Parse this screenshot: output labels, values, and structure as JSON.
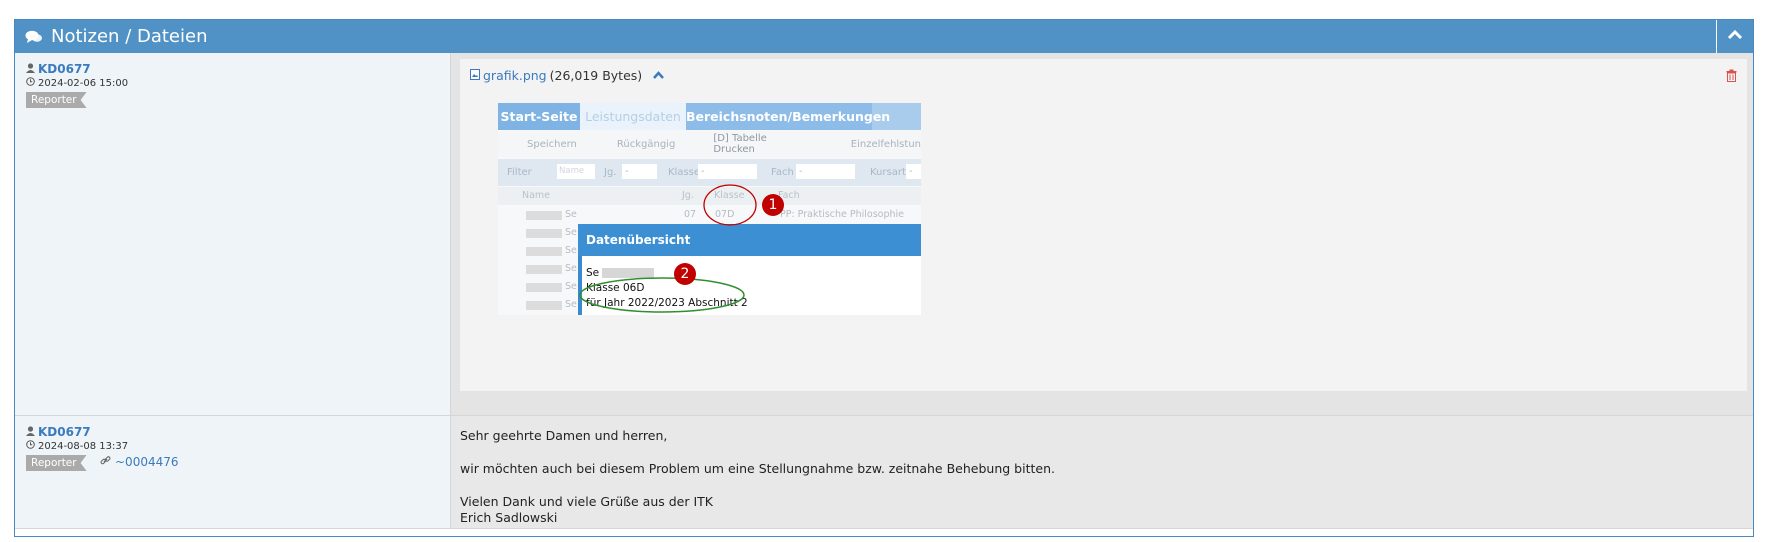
{
  "panel": {
    "title": "Notizen / Dateien",
    "icon": "comments-icon",
    "collapse_icon": "chevron-up-icon"
  },
  "notes": [
    {
      "user": "KD0677",
      "date": "2024-02-06 15:00",
      "role": "Reporter",
      "attachment": {
        "file_name": "grafik.png",
        "file_size": "(26,019 Bytes)",
        "preview": {
          "tabs": [
            "Start-Seite",
            "Leistungsdaten",
            "Bereichsnoten/Bemerkungen"
          ],
          "toolbar": [
            "Speichern",
            "Rückgängig",
            "[D] Tabelle Drucken",
            "Einzelfehlstun"
          ],
          "filter": {
            "label": "Filter",
            "name_placeholder": "Name",
            "fields": [
              {
                "label": "Jg.",
                "value": "-"
              },
              {
                "label": "Klasse",
                "value": "-"
              },
              {
                "label": "Fach",
                "value": "-"
              },
              {
                "label": "Kursart",
                "value": "-"
              }
            ]
          },
          "columns": [
            "Name",
            "Jg.",
            "Klasse",
            "Fach"
          ],
          "first_row": {
            "name": "Se",
            "jg": "07",
            "klasse": "07D",
            "fach": "PP: Praktische Philosophie"
          },
          "other_rows": [
            "Se",
            "Se",
            "Se",
            "Se",
            "Se"
          ],
          "popup": {
            "title": "Datenübersicht",
            "name": "Se",
            "klasse": "Klasse 06D",
            "jahr": "für Jahr 2022/2023 Abschnitt 2"
          },
          "markers": [
            "1",
            "2"
          ]
        }
      }
    },
    {
      "user": "KD0677",
      "date": "2024-08-08 13:37",
      "role": "Reporter",
      "relation": "~0004476",
      "message": [
        "Sehr geehrte Damen und herren,",
        "wir möchten auch bei diesem Problem um eine Stellungnahme bzw. zeitnahe Behebung bitten.",
        "Vielen Dank und viele Grüße aus der ITK",
        "Erich Sadlowski"
      ]
    }
  ],
  "colors": {
    "header": "#5092c6",
    "link": "#3a7bbd",
    "badge": "#aaaaaa",
    "marker": "#c10000"
  }
}
